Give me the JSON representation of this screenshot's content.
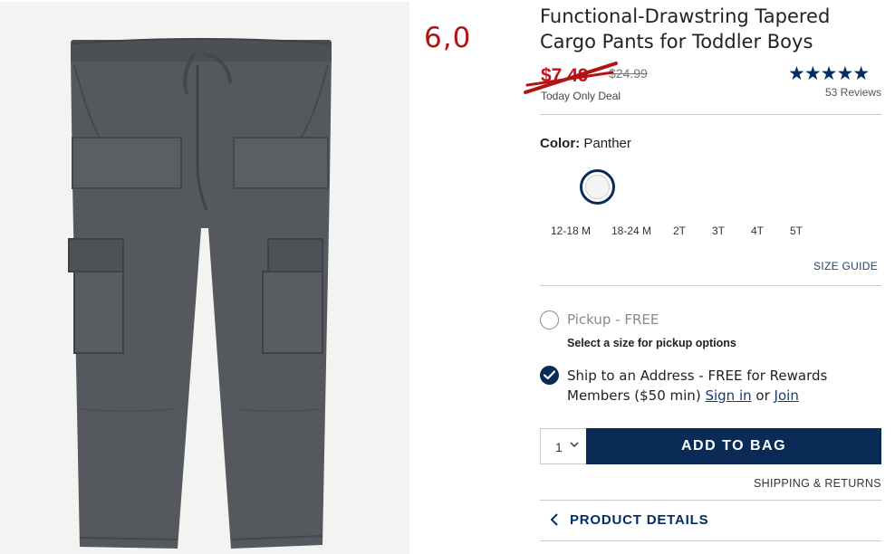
{
  "annotation": {
    "handwritten_rating": "6,0"
  },
  "product": {
    "title": "Functional-Drawstring Tapered Cargo Pants for Toddler Boys",
    "sale_price": "$7.49",
    "original_price": "$24.99",
    "deal_label": "Today Only Deal",
    "rating_stars": "★★★★★",
    "reviews_label": "53 Reviews"
  },
  "color": {
    "label": "Color:",
    "value": "Panther"
  },
  "sizes": [
    "12-18 M",
    "18-24 M",
    "2T",
    "3T",
    "4T",
    "5T"
  ],
  "size_guide": "SIZE GUIDE",
  "fulfillment": {
    "pickup_label": "Pickup - FREE",
    "pickup_note": "Select a size for pickup options",
    "ship_label": "Ship to an Address - FREE for Rewards Members ($50 min)",
    "sign_in": "Sign in",
    "or": "or",
    "join": "Join"
  },
  "cart": {
    "quantity": "1",
    "add_to_bag": "ADD TO BAG"
  },
  "shipping_returns": "SHIPPING & RETURNS",
  "product_details": "PRODUCT DETAILS",
  "colors": {
    "brand_navy": "#0b2b57",
    "sale_red": "#c1121f",
    "pants_gray": "#55585d",
    "annotation_red": "#b01515"
  }
}
